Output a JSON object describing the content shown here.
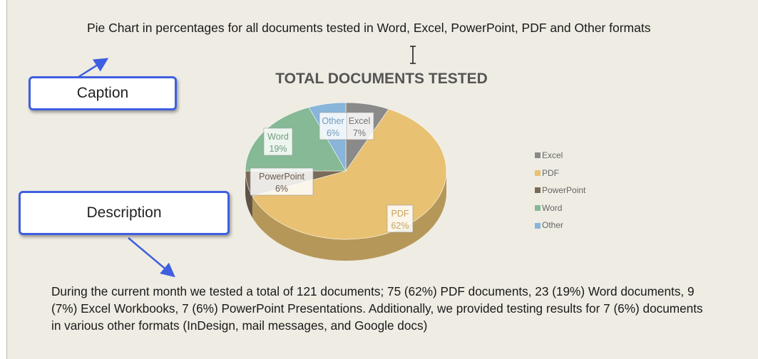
{
  "caption": {
    "text": "Pie Chart in percentages for all documents tested in Word, Excel, PowerPoint, PDF and Other formats",
    "callout_label": "Caption"
  },
  "description": {
    "callout_label": "Description",
    "text": "During the current month we tested a total of 121 documents; 75 (62%) PDF documents, 23 (19%) Word documents, 9 (7%) Excel Workbooks, 7 (6%) PowerPoint Presentations. Additionally, we provided testing results for 7 (6%) documents in various other formats (InDesign, mail messages, and Google docs)"
  },
  "chart_data": {
    "type": "pie",
    "title": "TOTAL DOCUMENTS TESTED",
    "legend_position": "right",
    "slices": [
      {
        "name": "Excel",
        "value": 7,
        "label": "7%",
        "color": "#8a8a8a"
      },
      {
        "name": "PDF",
        "value": 62,
        "label": "62%",
        "color": "#e8c172"
      },
      {
        "name": "PowerPoint",
        "value": 6,
        "label": "6%",
        "color": "#7a6a58"
      },
      {
        "name": "Word",
        "value": 19,
        "label": "19%",
        "color": "#86b995"
      },
      {
        "name": "Other",
        "value": 6,
        "label": "6%",
        "color": "#88b5d9"
      }
    ]
  },
  "colors": {
    "callout_border": "#3f5fe0",
    "page_background": "#efece3"
  },
  "icons": {
    "cursor": "text-cursor-icon"
  }
}
